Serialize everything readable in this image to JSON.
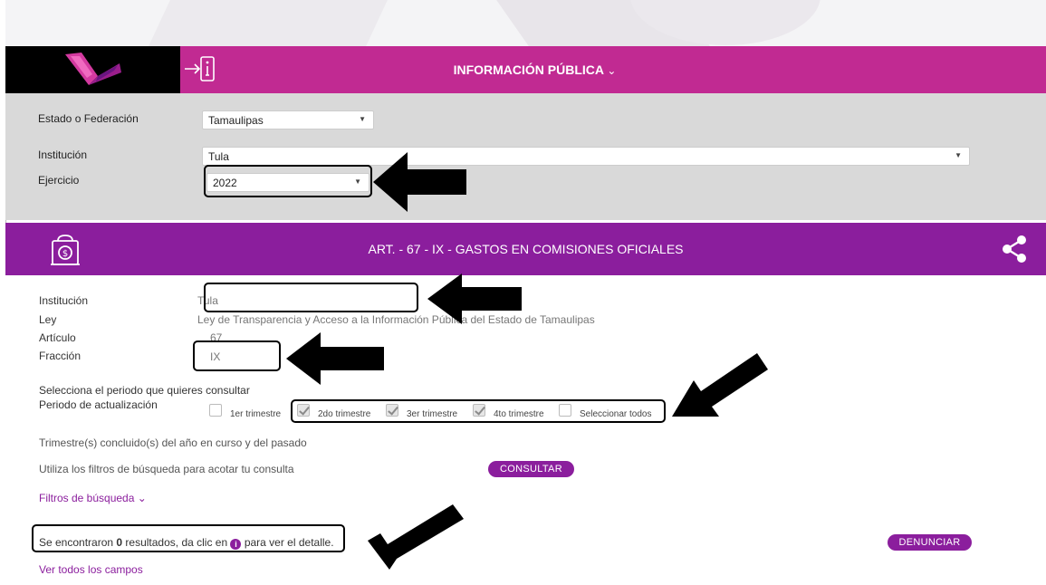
{
  "header": {
    "title": "INFORMACIÓN PÚBLICA",
    "chevron": "⌄"
  },
  "filters": {
    "estado_label": "Estado o Federación",
    "estado_value": "Tamaulipas",
    "institucion_label": "Institución",
    "institucion_value": "Tula",
    "ejercicio_label": "Ejercicio",
    "ejercicio_value": "2022"
  },
  "article": {
    "title": "ART. - 67 - IX - GASTOS EN COMISIONES OFICIALES"
  },
  "info": {
    "institucion_label": "Institución",
    "institucion_value": "Tula",
    "ley_label": "Ley",
    "ley_value": "Ley de Transparencia y Acceso a la Información Pública del Estado de Tamaulipas",
    "articulo_label": "Artículo",
    "articulo_value": "67",
    "fraccion_label": "Fracción",
    "fraccion_value": "IX"
  },
  "periodo": {
    "prompt": "Selecciona el periodo que quieres consultar",
    "label": "Periodo de actualización",
    "options": [
      {
        "label": "1er trimestre",
        "checked": false
      },
      {
        "label": "2do trimestre",
        "checked": true
      },
      {
        "label": "3er trimestre",
        "checked": true
      },
      {
        "label": "4to trimestre",
        "checked": true
      },
      {
        "label": "Seleccionar todos",
        "checked": false
      }
    ]
  },
  "notes": {
    "trimestres": "Trimestre(s) concluido(s) del año en curso y del pasado",
    "filtros_hint": "Utiliza los filtros de búsqueda para acotar tu consulta",
    "consultar": "CONSULTAR",
    "filtros_link": "Filtros de búsqueda",
    "filtros_chevron": "⌄"
  },
  "results": {
    "prefix": "Se encontraron ",
    "count": "0",
    "suffix_a": " resultados, da clic en ",
    "suffix_b": " para ver el detalle.",
    "denunciar": "DENUNCIAR",
    "ver_todos": "Ver todos los campos"
  },
  "colors": {
    "header": "#c12a92",
    "article_bar": "#8b1e9d",
    "filter_bg": "#d9d9d9"
  },
  "icons": [
    "logo",
    "login-icon",
    "money-bag-icon",
    "share-icon",
    "info-circle-icon",
    "chevron-down-icon",
    "arrow-annotation"
  ]
}
